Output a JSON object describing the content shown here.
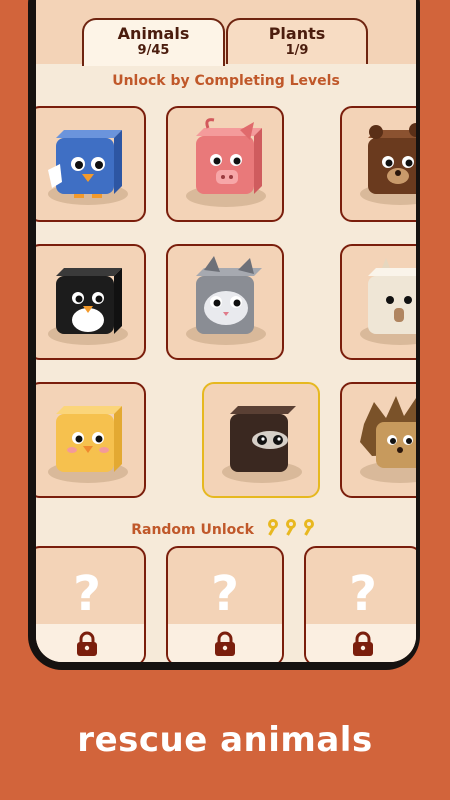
{
  "tabs": [
    {
      "label": "Animals",
      "count": "9/45"
    },
    {
      "label": "Plants",
      "count": "1/9"
    }
  ],
  "section_unlock": "Unlock by Completing Levels",
  "section_random": "Random Unlock",
  "random_cost_icon": "key-icon",
  "animals": [
    {
      "name": "blue-bird",
      "icon": "bird-icon",
      "color": "#3f6fc4"
    },
    {
      "name": "pig",
      "icon": "pig-icon",
      "color": "#e9797a"
    },
    {
      "name": "bear",
      "icon": "bear-icon",
      "color": "#6a3a1e"
    },
    {
      "name": "penguin",
      "icon": "penguin-icon",
      "color": "#1c1c1c"
    },
    {
      "name": "cat",
      "icon": "cat-icon",
      "color": "#8a8d94"
    },
    {
      "name": "sheep",
      "icon": "sheep-icon",
      "color": "#efe6d6"
    },
    {
      "name": "chick",
      "icon": "chick-icon",
      "color": "#f6c14e"
    },
    {
      "name": "raccoon",
      "icon": "raccoon-icon",
      "color": "#3a2820"
    },
    {
      "name": "hedgehog",
      "icon": "hedgehog-icon",
      "color": "#a5743f"
    }
  ],
  "locked_slots": [
    {
      "symbol": "?"
    },
    {
      "symbol": "?"
    },
    {
      "symbol": "?"
    }
  ],
  "caption": "rescue animals"
}
